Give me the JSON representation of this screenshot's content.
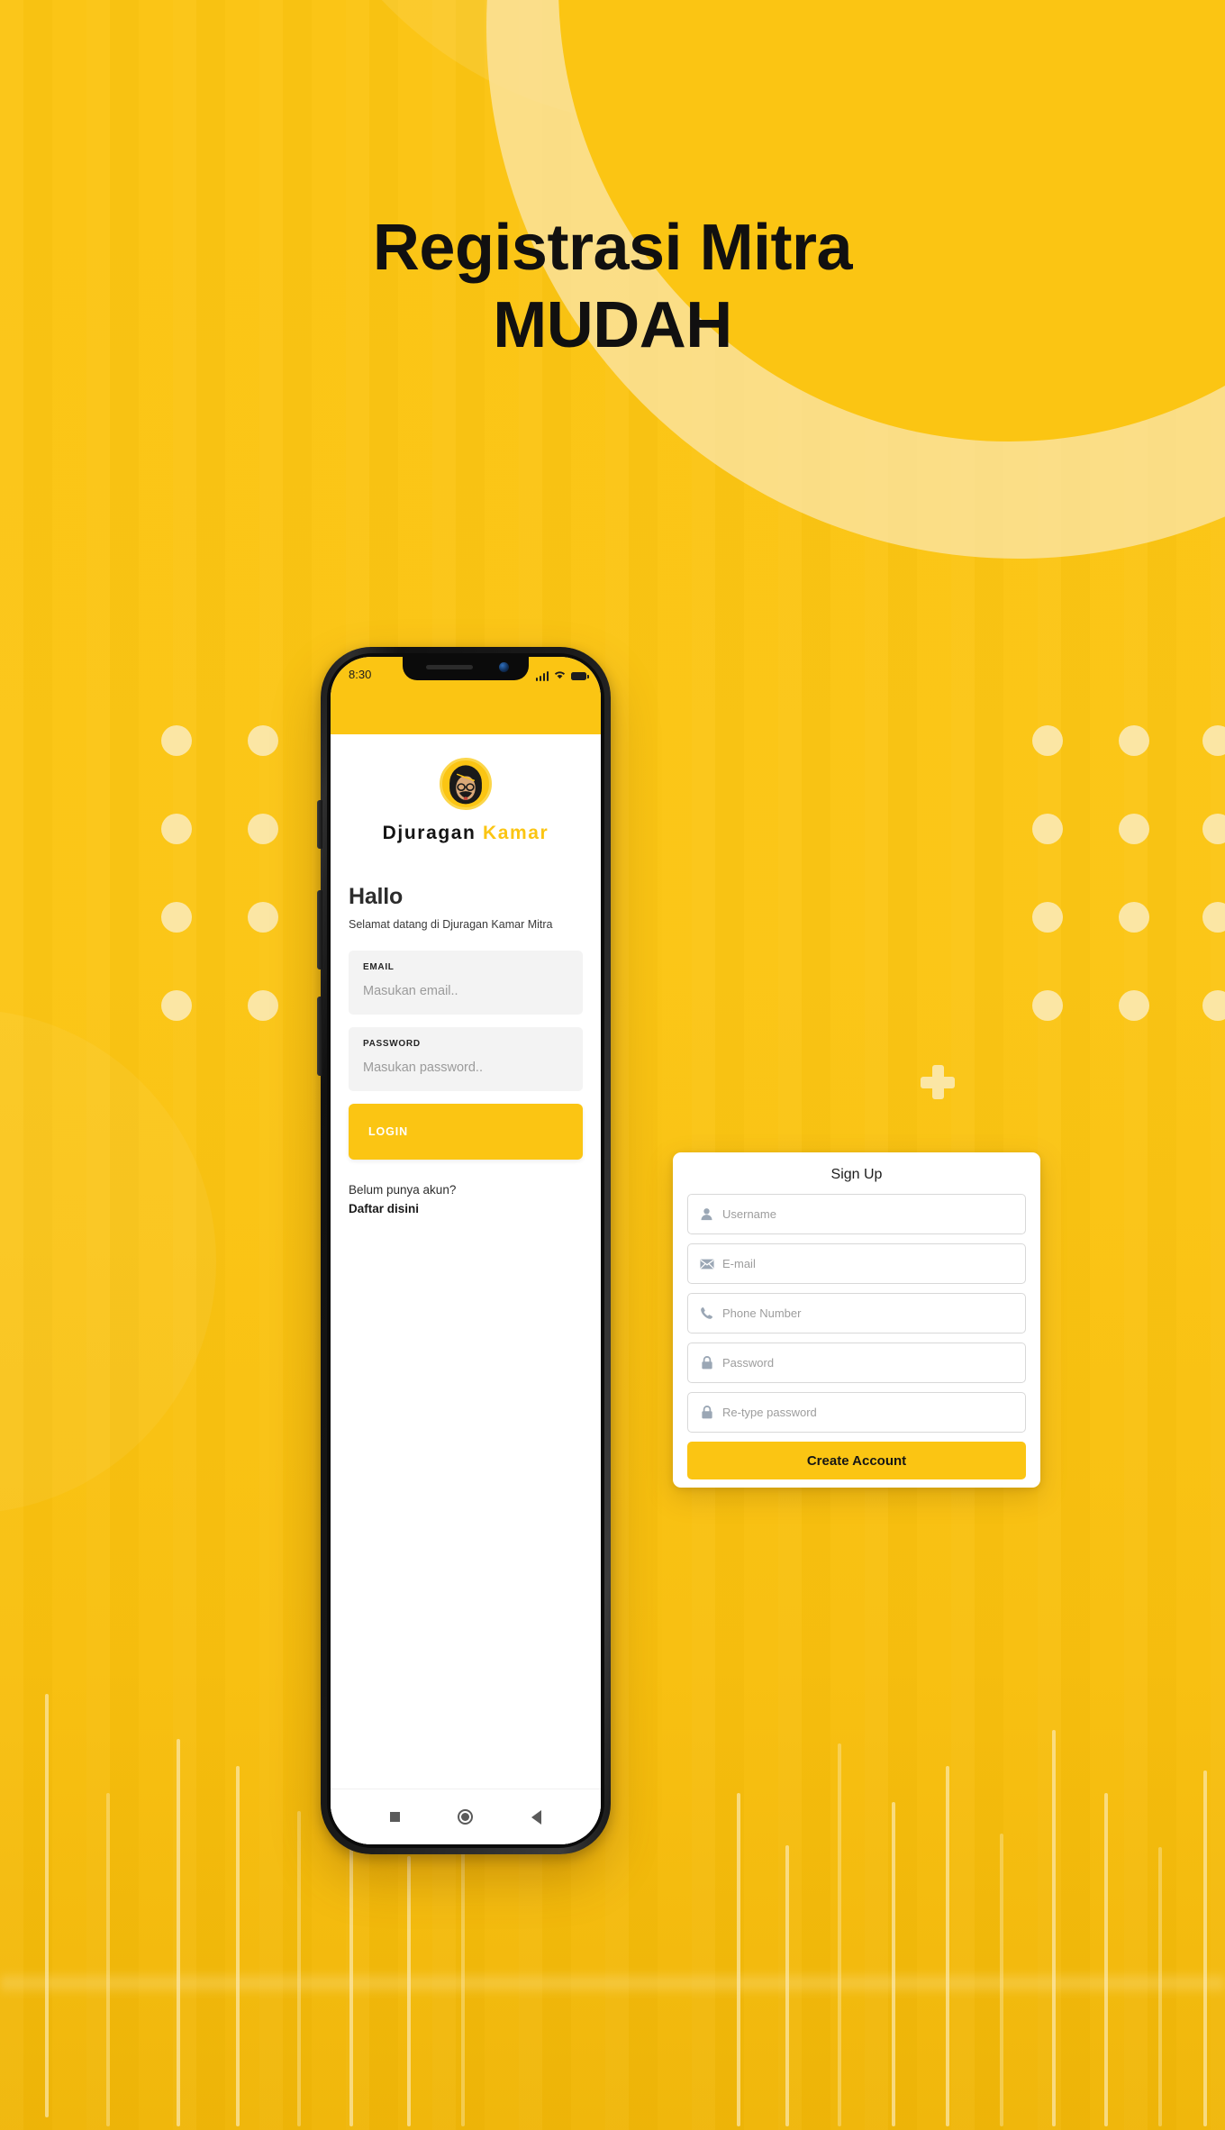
{
  "headline": {
    "line1": "Registrasi Mitra",
    "line2": "MUDAH"
  },
  "colors": {
    "brand_yellow": "#FBC513",
    "cream": "#FBE6A4",
    "text_dark": "#111010"
  },
  "phone": {
    "status_bar": {
      "time": "8:30",
      "signal_icon": "signal-bars-icon",
      "wifi_icon": "wifi-icon",
      "battery_icon": "battery-icon"
    },
    "logo": {
      "avatar_icon": "djuragan-avatar-icon",
      "name_primary": "Djuragan",
      "name_accent": "Kamar"
    },
    "greeting": {
      "title": "Hallo",
      "subtitle": "Selamat datang di Djuragan Kamar Mitra"
    },
    "login_form": {
      "fields": [
        {
          "label": "EMAIL",
          "placeholder": "Masukan email.."
        },
        {
          "label": "PASSWORD",
          "placeholder": "Masukan password.."
        }
      ],
      "submit_label": "LOGIN"
    },
    "signup_prompt": {
      "question": "Belum punya akun?",
      "action": "Daftar disini"
    },
    "navbar": {
      "recents_icon": "square-recents-icon",
      "home_icon": "circle-home-icon",
      "back_icon": "triangle-back-icon"
    }
  },
  "signup_card": {
    "title": "Sign Up",
    "fields": [
      {
        "placeholder": "Username",
        "icon": "person-icon"
      },
      {
        "placeholder": "E-mail",
        "icon": "envelope-icon"
      },
      {
        "placeholder": "Phone Number",
        "icon": "phone-icon"
      },
      {
        "placeholder": "Password",
        "icon": "lock-icon"
      },
      {
        "placeholder": "Re-type password",
        "icon": "lock-icon"
      }
    ],
    "submit_label": "Create Account"
  }
}
